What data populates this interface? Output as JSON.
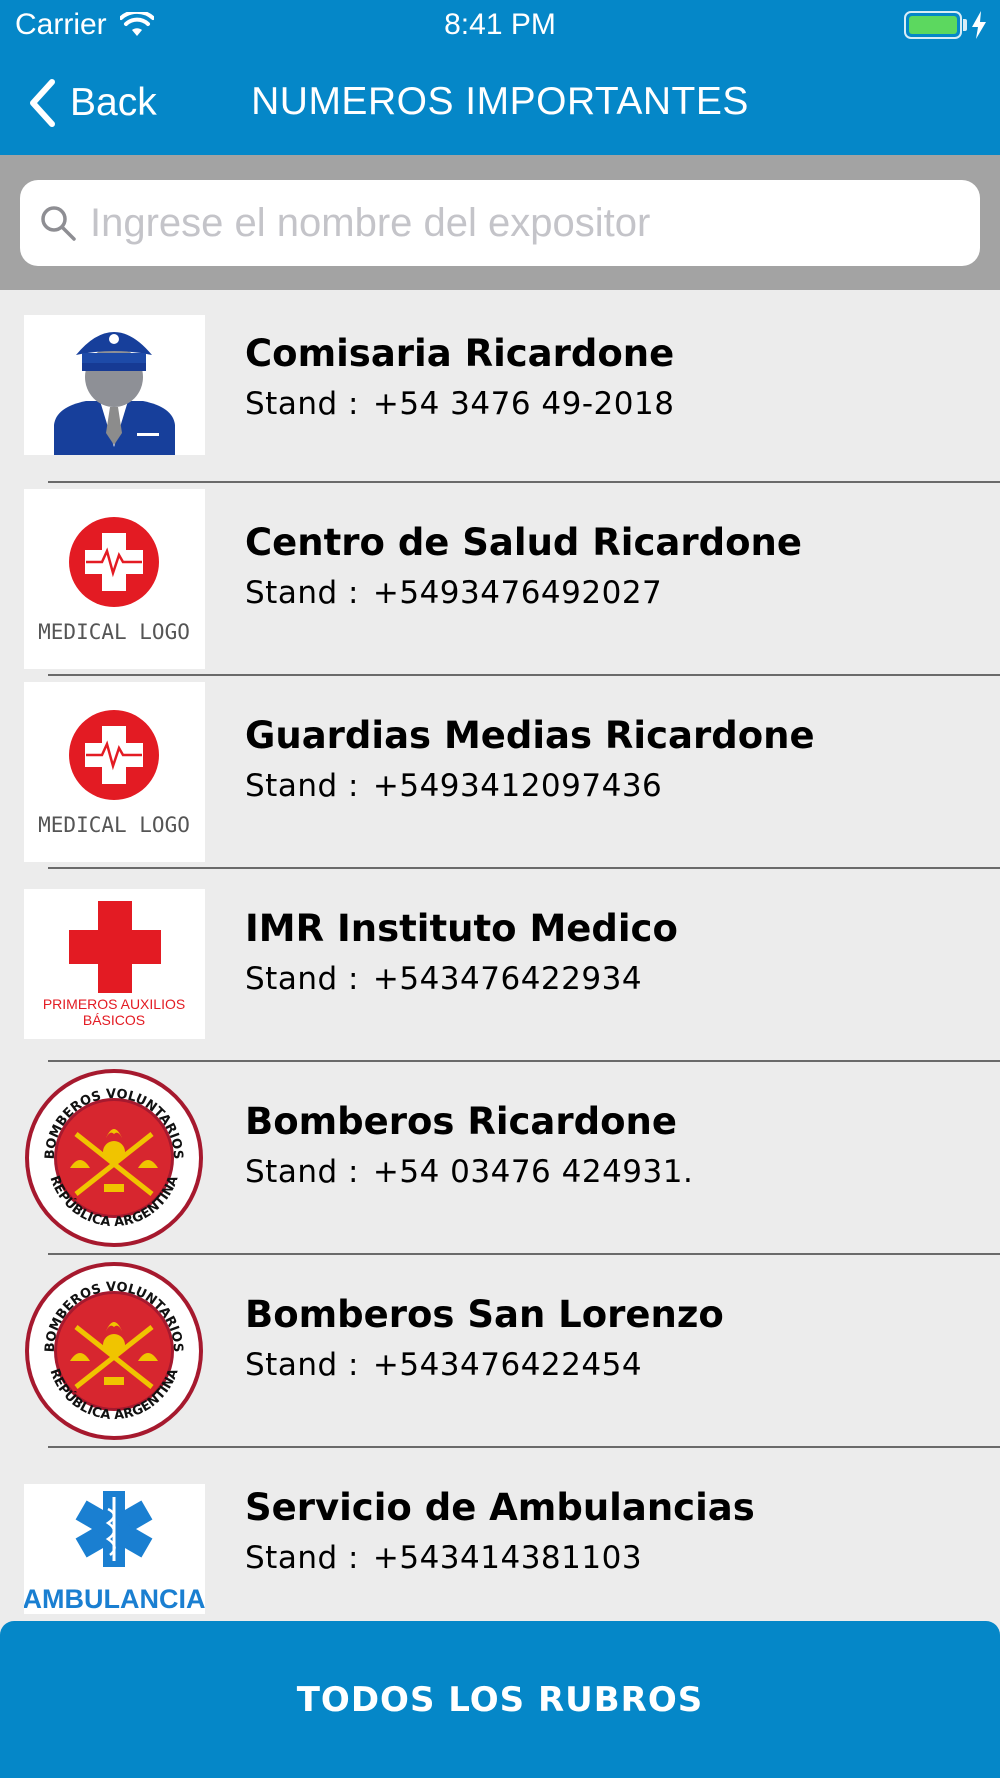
{
  "status_bar": {
    "carrier": "Carrier",
    "time": "8:41 PM"
  },
  "nav": {
    "back_label": "Back",
    "title": "NUMEROS IMPORTANTES"
  },
  "search": {
    "placeholder": "Ingrese el nombre del expositor",
    "value": ""
  },
  "list": {
    "items": [
      {
        "name": "Comisaria Ricardone",
        "label": "Stand :",
        "phone": "+54 3476 49-2018",
        "logo": "police-officer-icon"
      },
      {
        "name": "Centro de Salud Ricardone",
        "label": "Stand :",
        "phone": "+5493476492027",
        "logo": "medical-logo",
        "logo_text": "MEDICAL LOGO"
      },
      {
        "name": "Guardias Medias Ricardone",
        "label": "Stand :",
        "phone": "+5493412097436",
        "logo": "medical-logo",
        "logo_text": "MEDICAL LOGO"
      },
      {
        "name": "IMR Instituto Medico",
        "label": "Stand :",
        "phone": "+543476422934",
        "logo": "red-cross-logo",
        "logo_text_1": "PRIMEROS AUXILIOS",
        "logo_text_2": "BÁSICOS"
      },
      {
        "name": "Bomberos Ricardone",
        "label": "Stand :",
        "phone": "+54 03476 424931.",
        "logo": "bomberos-emblem",
        "logo_text_top": "BOMBEROS VOLUNTARIOS",
        "logo_text_bottom": "REPÚBLICA ARGENTINA"
      },
      {
        "name": "Bomberos San Lorenzo",
        "label": "Stand :",
        "phone": "+543476422454",
        "logo": "bomberos-emblem",
        "logo_text_top": "BOMBEROS VOLUNTARIOS",
        "logo_text_bottom": "REPÚBLICA ARGENTINA"
      },
      {
        "name": "Servicio de Ambulancias",
        "label": "Stand :",
        "phone": "+543414381103",
        "logo": "star-of-life-logo",
        "logo_text": "AMBULANCIA"
      }
    ]
  },
  "bottom_button": {
    "label": "TODOS LOS RUBROS"
  },
  "colors": {
    "primary": "#0587c8",
    "search_band": "#a3a3a3",
    "list_bg": "#ececec",
    "medical_red": "#e31b23"
  }
}
